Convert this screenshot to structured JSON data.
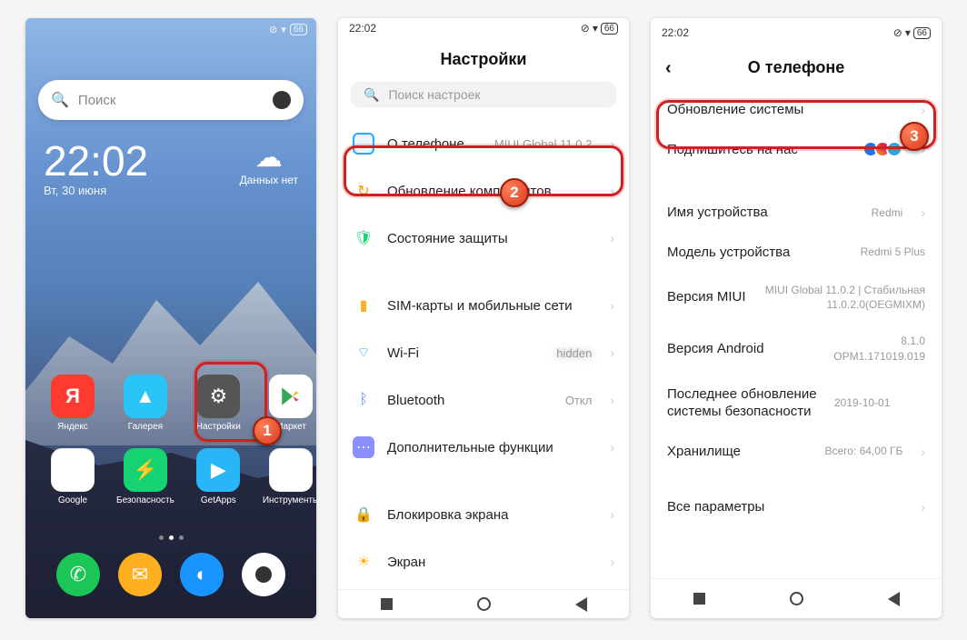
{
  "status": {
    "time": "22:02",
    "battery": "66"
  },
  "home": {
    "search_placeholder": "Поиск",
    "clock": "22:02",
    "date": "Вт, 30 июня",
    "weather": "Данных нет",
    "apps": {
      "yandex": "Яндекс",
      "gallery": "Галерея",
      "settings": "Настройки",
      "market": "Маркет",
      "google": "Google",
      "security": "Безопасность",
      "getapps": "GetApps",
      "tools": "Инструменты"
    }
  },
  "settings": {
    "title": "Настройки",
    "search_placeholder": "Поиск настроек",
    "rows": {
      "about": {
        "label": "О телефоне",
        "value": "MIUI Global 11.0.2"
      },
      "update_components": {
        "label": "Обновление компонентов"
      },
      "security_state": {
        "label": "Состояние защиты"
      },
      "sim": {
        "label": "SIM-карты и мобильные сети"
      },
      "wifi": {
        "label": "Wi-Fi",
        "value": "blurred"
      },
      "bt": {
        "label": "Bluetooth",
        "value": "Откл"
      },
      "more": {
        "label": "Дополнительные функции"
      },
      "lock": {
        "label": "Блокировка экрана"
      },
      "screen": {
        "label": "Экран"
      }
    }
  },
  "about": {
    "title": "О телефоне",
    "rows": {
      "system_update": "Обновление системы",
      "subscribe": "Подпишитесь на нас",
      "device_name": {
        "label": "Имя устройства",
        "value": "Redmi"
      },
      "model": {
        "label": "Модель устройства",
        "value": "Redmi 5 Plus"
      },
      "miui": {
        "label": "Версия MIUI",
        "value": "MIUI Global 11.0.2 | Стабильная\n11.0.2.0(OEGMIXM)"
      },
      "android": {
        "label": "Версия Android",
        "value": "8.1.0\nOPM1.171019.019"
      },
      "security_patch": {
        "label": "Последнее обновление системы безопасности",
        "value": "2019-10-01"
      },
      "storage": {
        "label": "Хранилище",
        "value": "Всего: 64,00 ГБ"
      },
      "all_params": "Все параметры"
    }
  }
}
